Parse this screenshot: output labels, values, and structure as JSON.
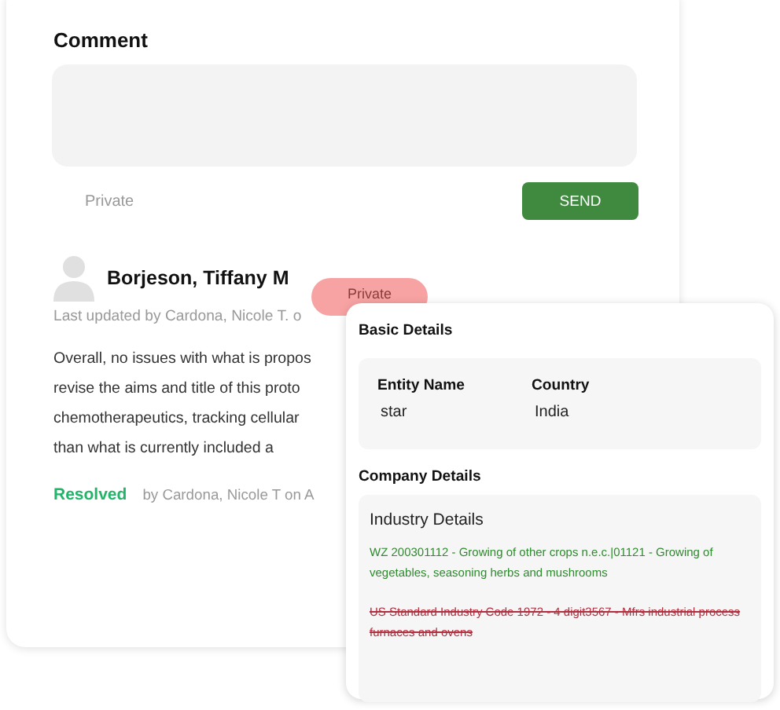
{
  "comment_form": {
    "title": "Comment",
    "private_label": "Private",
    "send_button": "SEND"
  },
  "comment": {
    "author": "Borjeson, Tiffany M",
    "badge": "Private",
    "updated": "Last updated by Cardona, Nicole T. o",
    "body": [
      "Overall, no issues with what is propos",
      "revise the aims and title of this proto",
      "chemotherapeutics, tracking cellular",
      "than what is currently included a"
    ],
    "status": "Resolved",
    "resolved_by": "by Cardona, Nicole T on A"
  },
  "popup": {
    "basic_title": "Basic Details",
    "fields": [
      {
        "label": "Entity Name",
        "value": "star"
      },
      {
        "label": "Country",
        "value": "India"
      }
    ],
    "company_title": "Company Details",
    "industry_title": "Industry Details",
    "industries": [
      {
        "text": "WZ 200301112 - Growing of other crops n.e.c.|01121 - Growing of vegetables, seasoning herbs and mushrooms",
        "kind": "added"
      },
      {
        "text": "US Standard Industry Code 1972 - 4 digit3567 - Mfrs industrial process furnaces and ovens",
        "kind": "removed"
      }
    ]
  }
}
